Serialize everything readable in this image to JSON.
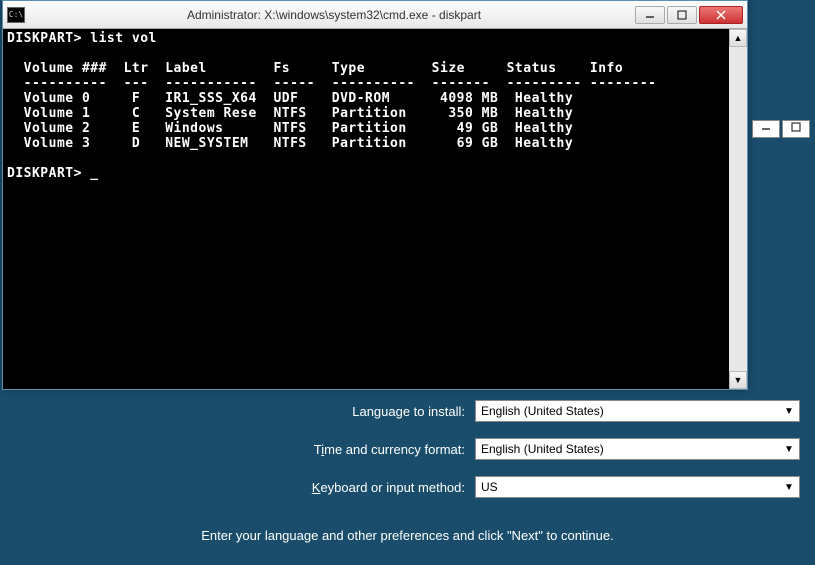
{
  "cmd": {
    "title": "Administrator: X:\\windows\\system32\\cmd.exe - diskpart",
    "icon_text": "C:\\",
    "prompt1": "DISKPART> ",
    "command1": "list vol",
    "header": {
      "volume": "Volume ###",
      "ltr": "Ltr",
      "label": "Label",
      "fs": "Fs",
      "type": "Type",
      "size": "Size",
      "status": "Status",
      "info": "Info"
    },
    "rows": [
      {
        "num": "Volume 0",
        "ltr": "F",
        "label": "IR1_SSS_X64",
        "fs": "UDF",
        "type": "DVD-ROM",
        "size": "4098 MB",
        "status": "Healthy"
      },
      {
        "num": "Volume 1",
        "ltr": "C",
        "label": "System Rese",
        "fs": "NTFS",
        "type": "Partition",
        "size": "350 MB",
        "status": "Healthy"
      },
      {
        "num": "Volume 2",
        "ltr": "E",
        "label": "Windows",
        "fs": "NTFS",
        "type": "Partition",
        "size": "49 GB",
        "status": "Healthy"
      },
      {
        "num": "Volume 3",
        "ltr": "D",
        "label": "NEW_SYSTEM",
        "fs": "NTFS",
        "type": "Partition",
        "size": "69 GB",
        "status": "Healthy"
      }
    ],
    "prompt2": "DISKPART> ",
    "cursor": "_"
  },
  "setup": {
    "lang_label": "Language to install:",
    "lang_value": "English (United States)",
    "time_label_pre": "T",
    "time_label_u": "i",
    "time_label_post": "me and currency format:",
    "time_value": "English (United States)",
    "kb_label_pre": "",
    "kb_label_u": "K",
    "kb_label_post": "eyboard or input method:",
    "kb_value": "US",
    "hint": "Enter your language and other preferences and click \"Next\" to continue."
  }
}
